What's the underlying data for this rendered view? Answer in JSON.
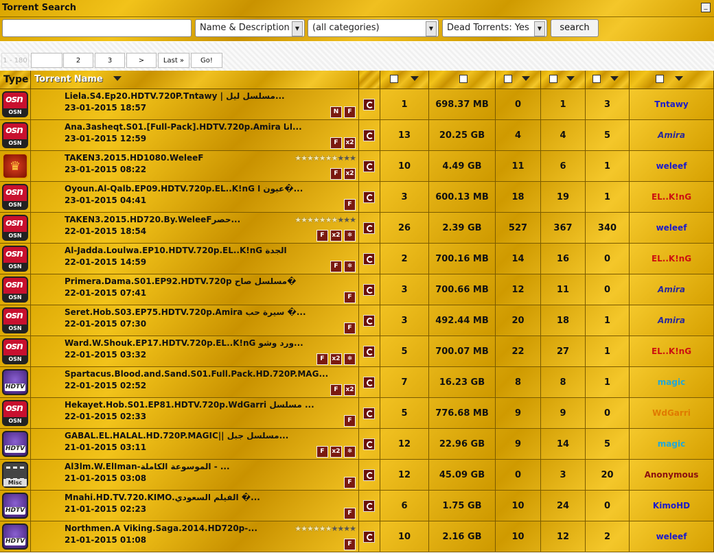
{
  "window": {
    "title": "Torrent Search"
  },
  "search": {
    "query_placeholder": "",
    "field_select": "Name & Description",
    "category_select": "(all categories)",
    "dead_select": "Dead Torrents: Yes",
    "button": "search"
  },
  "pager": {
    "range": "1 - 180",
    "pages": [
      "2",
      "3"
    ],
    "next": ">",
    "last": "Last »",
    "go": "Go!"
  },
  "table": {
    "headers": {
      "type": "Type",
      "name": "Torrent Name"
    },
    "colors": {
      "blue": "#1a1acc",
      "italic_blue": "#2a2a9a",
      "red": "#cc1010",
      "cyan": "#22a8d8",
      "brown": "#8a1010"
    },
    "rows": [
      {
        "icon": "osn",
        "name": "Liela.S4.Ep20.HDTV.720P.Tntawy | مسلسل ليل...",
        "date": "23-01-2015 18:57",
        "tags": [
          "N",
          "F"
        ],
        "files": "1",
        "size": "698.37 MB",
        "comments": "0",
        "seeders": "1",
        "leechers": "3",
        "uploader": "Tntawy",
        "uc": "#1a1acc",
        "it": false
      },
      {
        "icon": "osn",
        "name": "Ana.3asheqt.S01.[Full-Pack].HDTV.720p.Amira انا...",
        "date": "23-01-2015 12:59",
        "tags": [
          "F",
          "x2"
        ],
        "files": "13",
        "size": "20.25 GB",
        "comments": "4",
        "seeders": "4",
        "leechers": "5",
        "uploader": "Amira",
        "uc": "#2a2a9a",
        "it": true
      },
      {
        "icon": "crest",
        "name": "TAKEN3.2015.HD1080.WeleeF",
        "date": "23-01-2015 08:22",
        "tags": [
          "F",
          "x2"
        ],
        "stars": 7,
        "files": "10",
        "size": "4.49 GB",
        "comments": "11",
        "seeders": "6",
        "leechers": "1",
        "uploader": "weleef",
        "uc": "#1a1acc",
        "it": false
      },
      {
        "icon": "osn",
        "name": "Oyoun.Al-Qalb.EP09.HDTV.720p.EL..K!nG عيون ا�...",
        "date": "23-01-2015 04:41",
        "tags": [
          "F"
        ],
        "files": "3",
        "size": "600.13 MB",
        "comments": "18",
        "seeders": "19",
        "leechers": "1",
        "uploader": "EL..K!nG",
        "uc": "#cc1010",
        "it": false
      },
      {
        "icon": "osn",
        "name": "TAKEN3.2015.HD720.By.WeleeFحصر...",
        "date": "22-01-2015 18:54",
        "tags": [
          "F",
          "x2",
          "❄"
        ],
        "stars": 7,
        "files": "26",
        "size": "2.39 GB",
        "comments": "527",
        "seeders": "367",
        "leechers": "340",
        "uploader": "weleef",
        "uc": "#1a1acc",
        "it": false
      },
      {
        "icon": "osn",
        "name": "Al-Jadda.Loulwa.EP10.HDTV.720p.EL..K!nG الجدة",
        "date": "22-01-2015 14:59",
        "tags": [
          "F",
          "❄"
        ],
        "files": "2",
        "size": "700.16 MB",
        "comments": "14",
        "seeders": "16",
        "leechers": "0",
        "uploader": "EL..K!nG",
        "uc": "#cc1010",
        "it": false
      },
      {
        "icon": "osn",
        "name": "Primera.Dama.S01.EP92.HDTV.720p مسلسل صاح�",
        "date": "22-01-2015 07:41",
        "tags": [
          "F"
        ],
        "files": "3",
        "size": "700.66 MB",
        "comments": "12",
        "seeders": "11",
        "leechers": "0",
        "uploader": "Amira",
        "uc": "#2a2a9a",
        "it": true
      },
      {
        "icon": "osn",
        "name": "Seret.Hob.S03.EP75.HDTV.720p.Amira سيرة حب �...",
        "date": "22-01-2015 07:30",
        "tags": [
          "F"
        ],
        "files": "3",
        "size": "492.44 MB",
        "comments": "20",
        "seeders": "18",
        "leechers": "1",
        "uploader": "Amira",
        "uc": "#2a2a9a",
        "it": true
      },
      {
        "icon": "osn",
        "name": "Ward.W.Shouk.EP17.HDTV.720p.EL..K!nG ورد وشو...",
        "date": "22-01-2015 03:32",
        "tags": [
          "F",
          "x2",
          "❄"
        ],
        "files": "5",
        "size": "700.07 MB",
        "comments": "22",
        "seeders": "27",
        "leechers": "1",
        "uploader": "EL..K!nG",
        "uc": "#cc1010",
        "it": false
      },
      {
        "icon": "hdtv",
        "name": "Spartacus.Blood.and.Sand.S01.Full.Pack.HD.720P.MAG...",
        "date": "22-01-2015 02:52",
        "tags": [
          "F",
          "x2"
        ],
        "files": "7",
        "size": "16.23 GB",
        "comments": "8",
        "seeders": "8",
        "leechers": "1",
        "uploader": "magic",
        "uc": "#22a8d8",
        "it": false
      },
      {
        "icon": "osn",
        "name": "Hekayet.Hob.S01.EP81.HDTV.720p.WdGarri مسلسل ...",
        "date": "22-01-2015 02:33",
        "tags": [
          "F"
        ],
        "files": "5",
        "size": "776.68 MB",
        "comments": "9",
        "seeders": "9",
        "leechers": "0",
        "uploader": "WdGarri",
        "uc": "#e07a00",
        "it": false
      },
      {
        "icon": "hdtv",
        "name": "GABAL.EL.HALAL.HD.720P.MAGIC|| مسلسل جبل...",
        "date": "21-01-2015 03:11",
        "tags": [
          "F",
          "x2",
          "❄"
        ],
        "files": "12",
        "size": "22.96 GB",
        "comments": "9",
        "seeders": "14",
        "leechers": "5",
        "uploader": "magic",
        "uc": "#22a8d8",
        "it": false
      },
      {
        "icon": "misc",
        "name": "Al3lm.W.ElIman-الموسوعة الكاملة - ...",
        "date": "21-01-2015 03:08",
        "tags": [
          "F"
        ],
        "files": "12",
        "size": "45.09 GB",
        "comments": "0",
        "seeders": "3",
        "leechers": "20",
        "uploader": "Anonymous",
        "uc": "#8a1010",
        "it": false
      },
      {
        "icon": "hdtv",
        "name": "Mnahi.HD.TV.720.KIMO.الفيلم السعودي �...",
        "date": "21-01-2015 02:23",
        "tags": [
          "F"
        ],
        "files": "6",
        "size": "1.75 GB",
        "comments": "10",
        "seeders": "24",
        "leechers": "0",
        "uploader": "KimoHD",
        "uc": "#1a1acc",
        "it": false
      },
      {
        "icon": "hdtv",
        "name": "Northmen.A Viking.Saga.2014.HD720p-...",
        "date": "21-01-2015 01:08",
        "tags": [
          "F"
        ],
        "stars": 6,
        "files": "10",
        "size": "2.16 GB",
        "comments": "10",
        "seeders": "12",
        "leechers": "2",
        "uploader": "weleef",
        "uc": "#1a1acc",
        "it": false
      }
    ]
  }
}
